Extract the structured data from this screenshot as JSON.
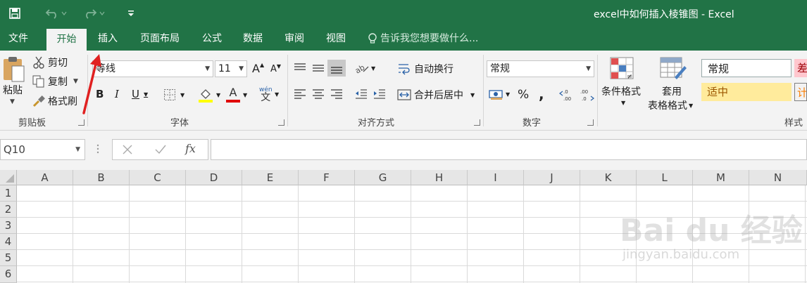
{
  "window": {
    "title": "excel中如何插入棱锥图 - Excel"
  },
  "tabs": [
    "文件",
    "开始",
    "插入",
    "页面布局",
    "公式",
    "数据",
    "审阅",
    "视图"
  ],
  "tell_me": "告诉我您想要做什么...",
  "clipboard": {
    "paste": "粘贴",
    "cut": "剪切",
    "copy": "复制",
    "painter": "格式刷",
    "label": "剪贴板"
  },
  "font": {
    "name": "等线",
    "size": "11",
    "label": "字体",
    "bold": "B",
    "italic": "I",
    "underline": "U",
    "grow": "A",
    "shrink": "A",
    "wen": "wén",
    "font_color_letter": "A"
  },
  "alignment": {
    "wrap": "自动换行",
    "merge": "合并后居中",
    "label": "对齐方式"
  },
  "number": {
    "format": "常规",
    "percent": "%",
    "comma": ",",
    "inc_dec": ".0\n.00",
    "dec_dec": ".00\n.0",
    "label": "数字"
  },
  "styles": {
    "cond_format": "条件格式",
    "table_format_1": "套用",
    "table_format_2": "表格格式",
    "normal": "常规",
    "bad": "差",
    "neutral": "适中",
    "calc": "计",
    "label": "样式"
  },
  "formula_bar": {
    "name_box": "Q10",
    "fx": "fx"
  },
  "columns": [
    "A",
    "B",
    "C",
    "D",
    "E",
    "F",
    "G",
    "H",
    "I",
    "J",
    "K",
    "L",
    "M",
    "N"
  ],
  "rows": [
    "1",
    "2",
    "3",
    "4",
    "5",
    "6"
  ],
  "watermark": {
    "brand": "Bai du 经验",
    "url": "jingyan.baidu.com"
  },
  "colors": {
    "excel_green": "#217346",
    "ribbon_bg": "#f3f3f3",
    "annotation_arrow": "#e02020"
  }
}
